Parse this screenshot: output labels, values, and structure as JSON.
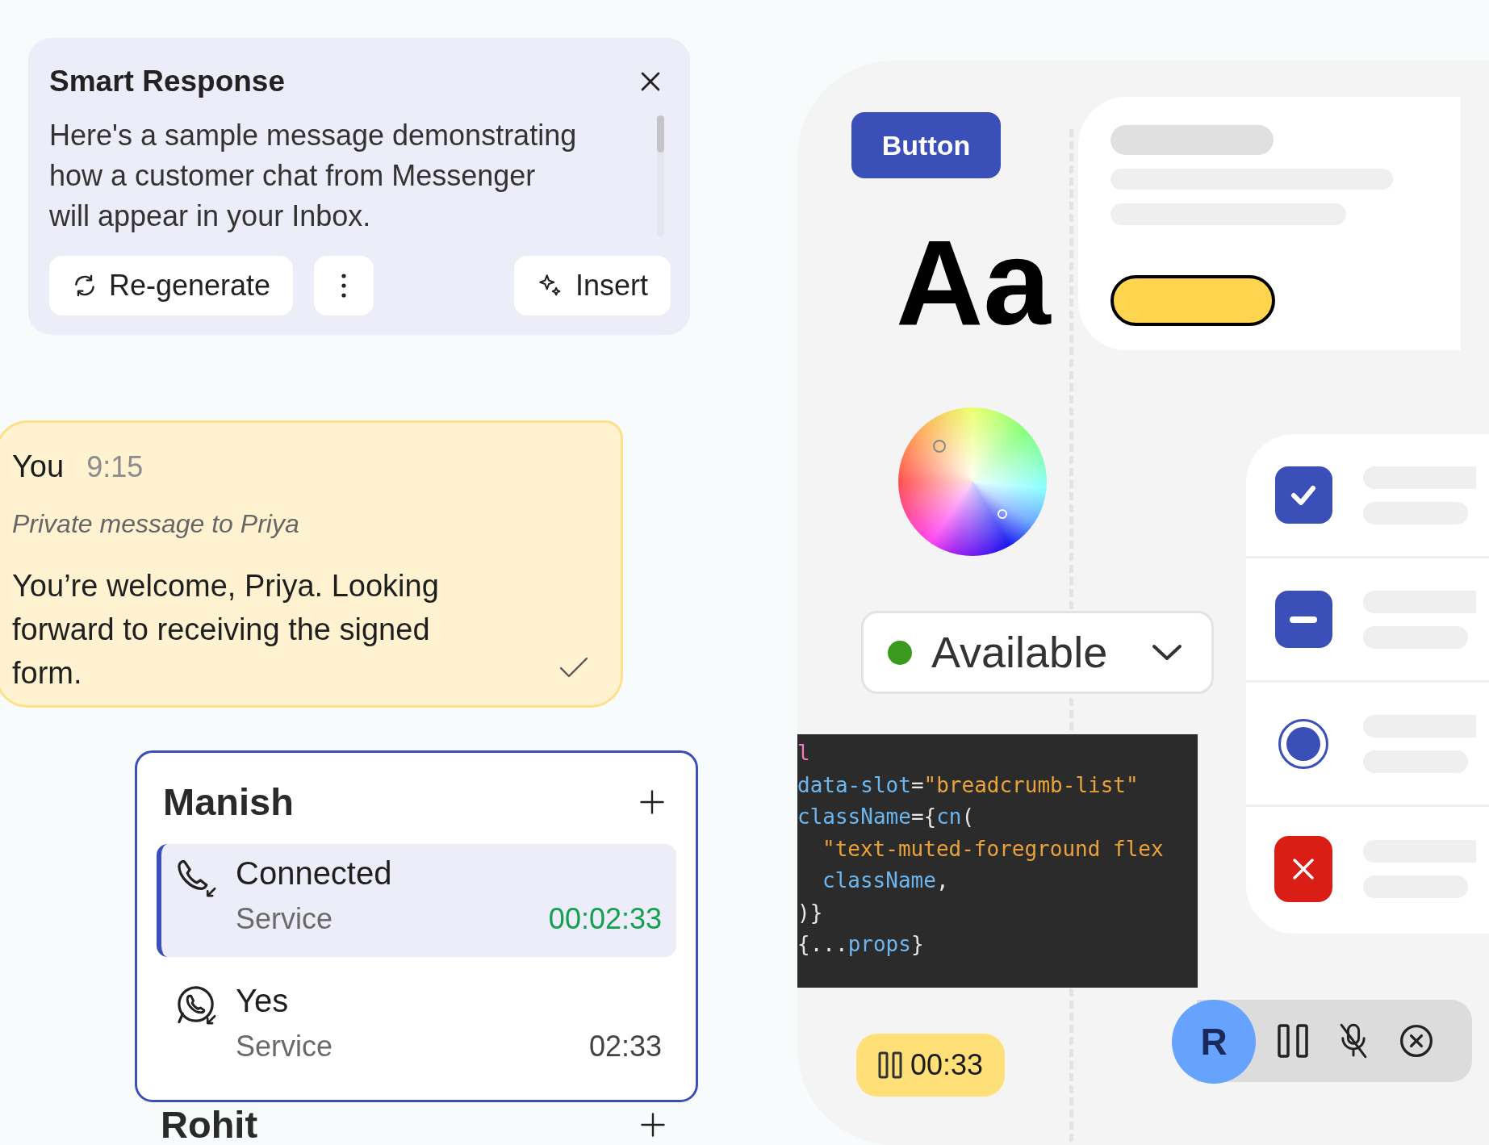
{
  "smart_response": {
    "title": "Smart Response",
    "body": "Here's a sample message demonstrating how a customer chat from Messenger will appear in your Inbox.",
    "actions": [
      {
        "kind": "regenerate",
        "label": "Re-generate"
      },
      {
        "kind": "more"
      },
      {
        "kind": "insert",
        "label": "Insert"
      }
    ]
  },
  "message": {
    "sender": "You",
    "time": "9:15",
    "note": "Private message to Priya",
    "text": "You’re welcome, Priya. Looking forward to receiving the signed form.",
    "delivered": true
  },
  "call_groups": [
    {
      "name": "Manish",
      "calls": [
        {
          "kind": "phone",
          "status": "Connected",
          "queue": "Service",
          "duration": "00:02:33",
          "selected": true
        },
        {
          "kind": "whatsapp",
          "status": "Yes",
          "queue": "Service",
          "duration": "02:33",
          "selected": false
        }
      ]
    },
    {
      "name": "Rohit"
    }
  ],
  "showcase": {
    "button_label": "Button",
    "type_sample": "Aa",
    "status": {
      "label": "Available",
      "color": "#3a9a1e"
    },
    "code_lines": [
      {
        "indented": false,
        "tokens": [
          {
            "kind": "tag",
            "text": "l"
          }
        ]
      },
      {
        "indented": false,
        "tokens": [
          {
            "kind": "attr",
            "text": "data-slot"
          },
          {
            "kind": "punct",
            "text": "="
          },
          {
            "kind": "str",
            "text": "\"breadcrumb-list\""
          }
        ]
      },
      {
        "indented": false,
        "tokens": [
          {
            "kind": "attr",
            "text": "className"
          },
          {
            "kind": "punct",
            "text": "={"
          },
          {
            "kind": "attr",
            "text": "cn"
          },
          {
            "kind": "punct",
            "text": "("
          }
        ]
      },
      {
        "indented": true,
        "tokens": [
          {
            "kind": "str",
            "text": "\"text-muted-foreground flex"
          }
        ]
      },
      {
        "indented": true,
        "tokens": [
          {
            "kind": "attr",
            "text": "className"
          },
          {
            "kind": "punct",
            "text": ","
          }
        ]
      },
      {
        "indented": false,
        "tokens": [
          {
            "kind": "punct",
            "text": ")}"
          }
        ]
      },
      {
        "indented": false,
        "tokens": [
          {
            "kind": "punct",
            "text": "{..."
          },
          {
            "kind": "attr",
            "text": "props"
          },
          {
            "kind": "punct",
            "text": "}"
          }
        ]
      }
    ],
    "options": [
      {
        "kind": "checkbox",
        "checked": true
      },
      {
        "kind": "checkbox",
        "indeterminate": true
      },
      {
        "kind": "radio",
        "selected": true
      },
      {
        "kind": "error"
      }
    ],
    "timer": "00:33",
    "caller_initial": "R"
  }
}
